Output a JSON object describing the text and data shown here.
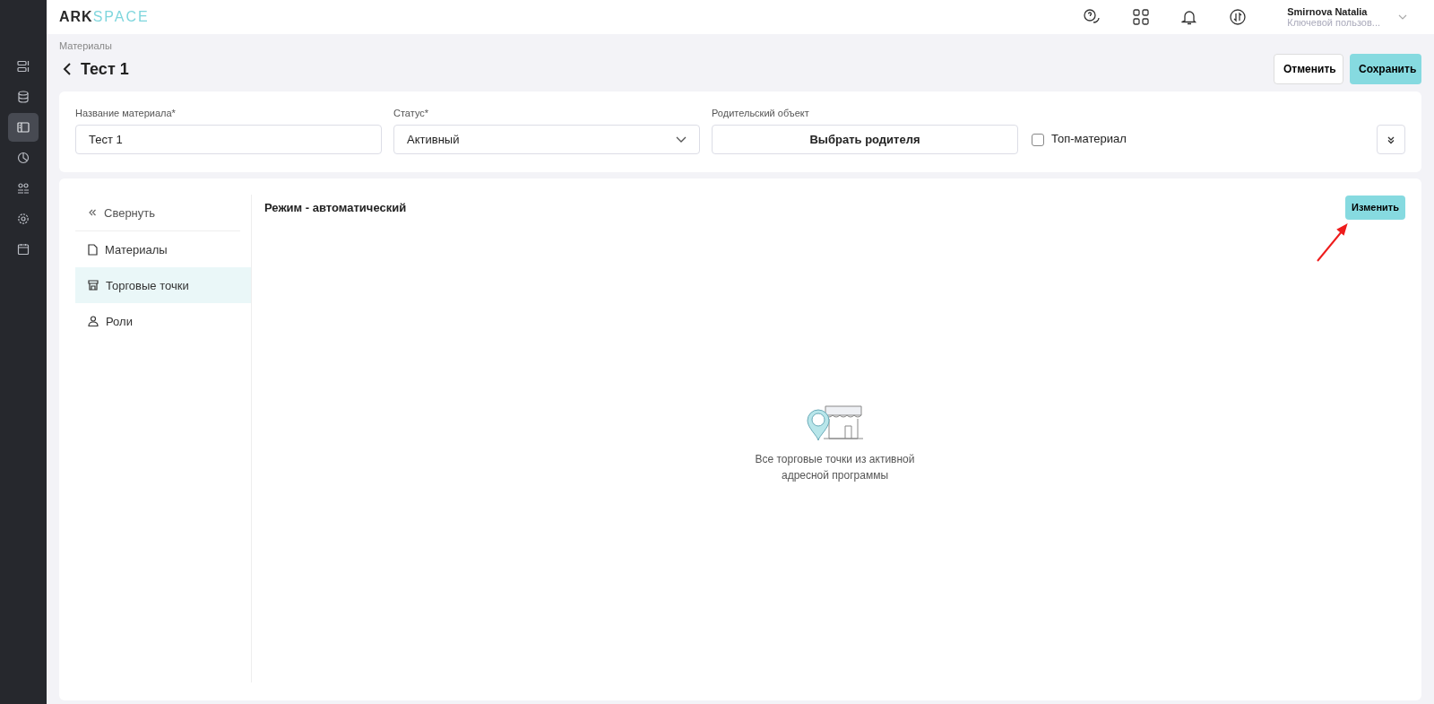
{
  "logo": {
    "first": "ARK",
    "second": "SPACE"
  },
  "nav_rail": [
    {
      "selected": false
    },
    {
      "selected": false
    },
    {
      "selected": true
    },
    {
      "selected": false
    },
    {
      "selected": false
    },
    {
      "selected": false
    },
    {
      "selected": false
    }
  ],
  "user": {
    "name": "Smirnova Natalia",
    "role": "Ключевой пользов..."
  },
  "breadcrumb": "Материалы",
  "title": "Тест 1",
  "buttons": {
    "cancel": "Отменить",
    "save": "Сохранить"
  },
  "form": {
    "name_label": "Название материала*",
    "name_value": "Тест 1",
    "status_label": "Статус*",
    "status_value": "Активный",
    "parent_label": "Родительский объект",
    "parent_button": "Выбрать родителя",
    "top_checkbox": {
      "label": "Топ-материал",
      "checked": false
    }
  },
  "side_menu": {
    "collapse": "Свернуть",
    "items": [
      {
        "label": "Материалы",
        "selected": false
      },
      {
        "label": "Торговые точки",
        "selected": true
      },
      {
        "label": "Роли",
        "selected": false
      }
    ]
  },
  "content": {
    "mode": "Режим - автоматический",
    "change_button": "Изменить",
    "empty_text_1": "Все торговые точки из активной",
    "empty_text_2": "адресной программы"
  }
}
